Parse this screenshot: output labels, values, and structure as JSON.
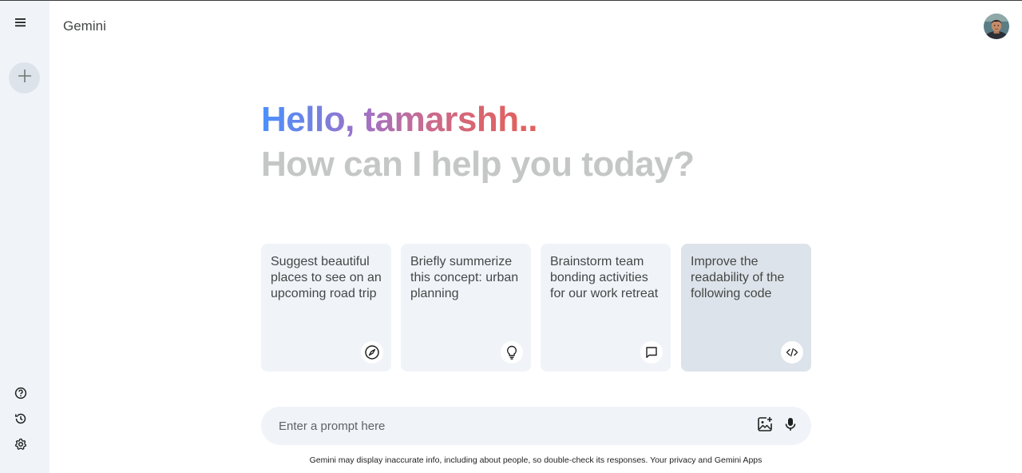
{
  "app": {
    "title": "Gemini"
  },
  "sidebar": {
    "menu_icon": "menu-icon",
    "new_chat_icon": "plus-icon",
    "bottom_items": [
      {
        "name": "help",
        "icon": "help-icon"
      },
      {
        "name": "activity",
        "icon": "history-icon"
      },
      {
        "name": "settings",
        "icon": "gear-icon"
      }
    ]
  },
  "greeting": {
    "hello": "Hello, tamarshh..",
    "subtitle": "How can I help you today?"
  },
  "suggestions": [
    {
      "text": "Suggest beautiful places to see on an upcoming road trip",
      "icon": "compass-icon"
    },
    {
      "text": "Briefly summerize this concept: urban planning",
      "icon": "lightbulb-icon"
    },
    {
      "text": "Brainstorm team bonding activities for our work retreat",
      "icon": "chat-bubble-icon"
    },
    {
      "text": "Improve the readability of the following code",
      "icon": "code-icon"
    }
  ],
  "prompt": {
    "placeholder": "Enter a prompt here",
    "value": ""
  },
  "footer": {
    "disclaimer": "Gemini may display inaccurate info, including about people, so double-check its responses.",
    "privacy_link": "Your privacy and Gemini Apps"
  },
  "colors": {
    "sidebar_bg": "#f0f4f9",
    "card_bg": "#f0f4f9",
    "card_active_bg": "#dde3ea",
    "gradient_start": "#4b90ff",
    "gradient_mid": "#9b72cb",
    "gradient_end": "#e2605a",
    "subtitle": "#c4c7c5"
  }
}
